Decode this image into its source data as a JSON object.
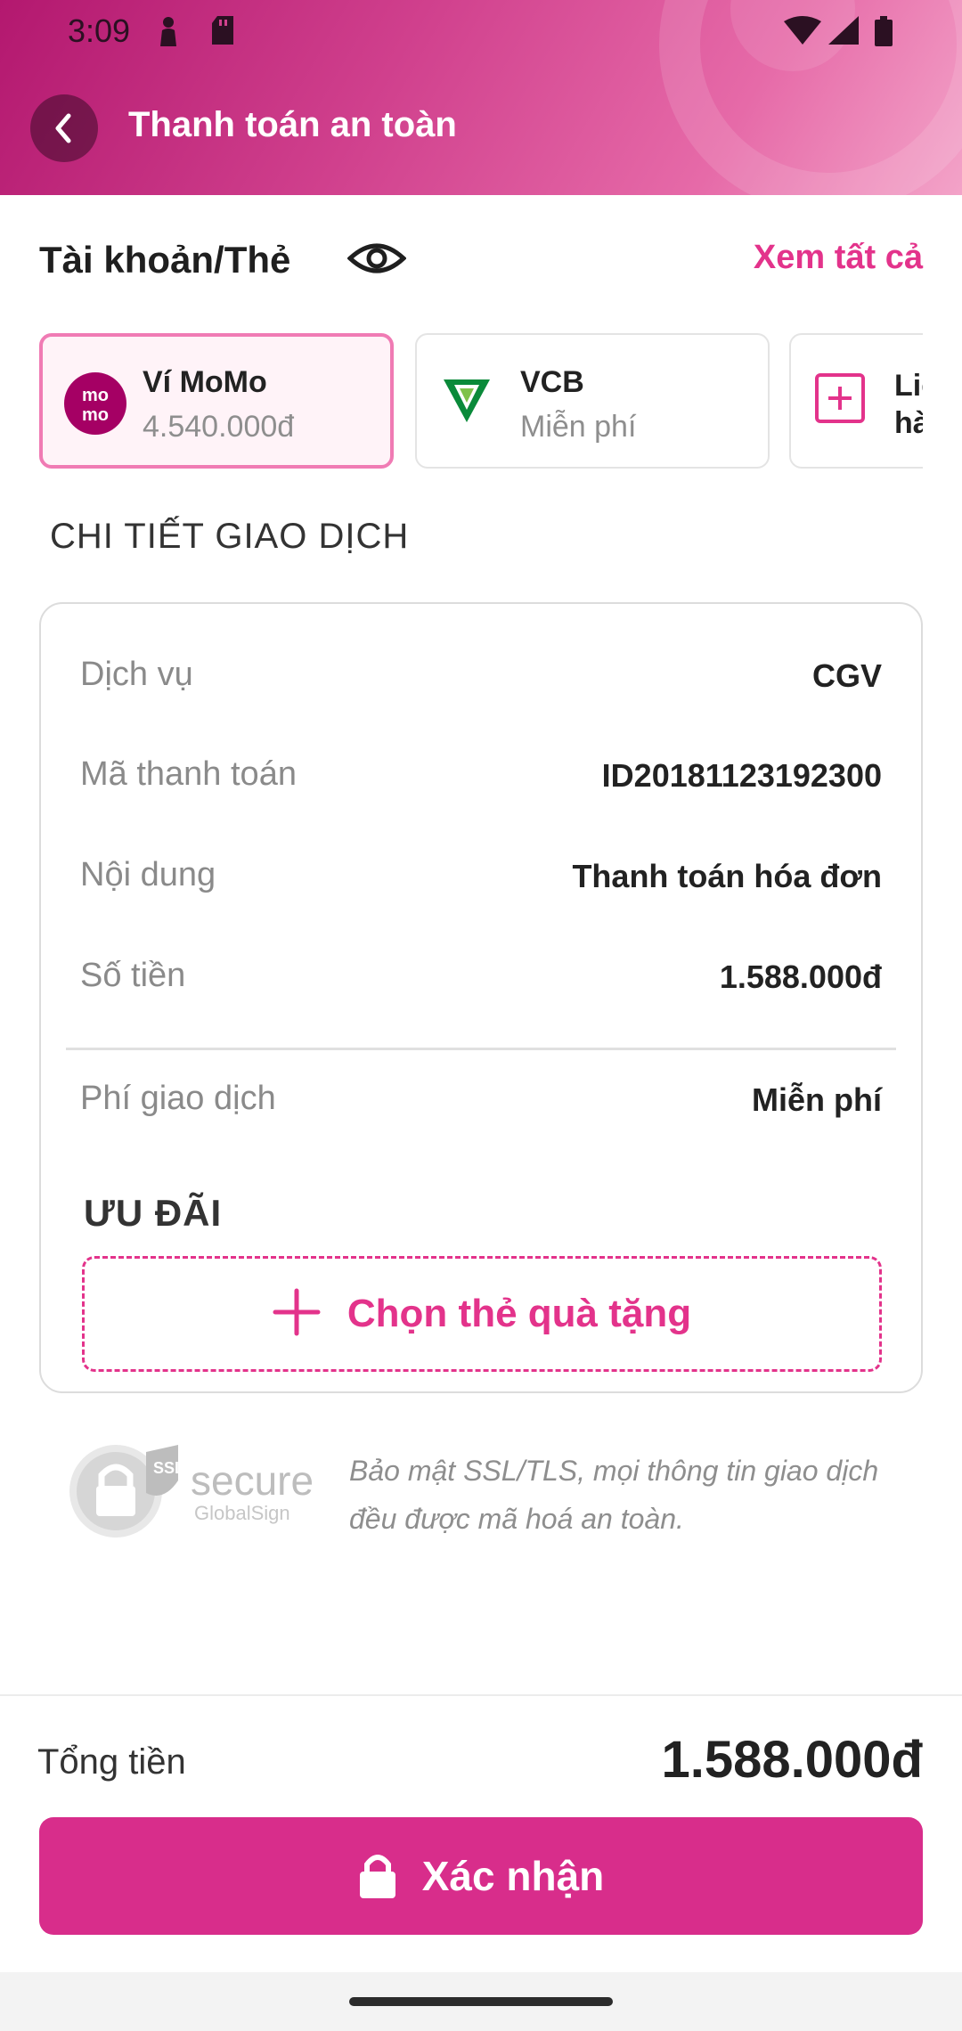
{
  "status_bar": {
    "time": "3:09"
  },
  "header": {
    "title": "Thanh toán an toàn"
  },
  "accounts": {
    "title": "Tài khoản/Thẻ",
    "see_all": "Xem tất cả",
    "cards": [
      {
        "name": "Ví MoMo",
        "sub": "4.540.000đ",
        "selected": true,
        "icon": "momo-logo"
      },
      {
        "name": "VCB",
        "sub": "Miễn phí",
        "selected": false,
        "icon": "vcb-logo"
      },
      {
        "name": "Liê",
        "sub": "hà",
        "selected": false,
        "icon": "add-card-icon"
      }
    ]
  },
  "details": {
    "section_title": "CHI TIẾT GIAO DỊCH",
    "rows": [
      {
        "label": "Dịch vụ",
        "value": "CGV"
      },
      {
        "label": "Mã thanh toán",
        "value": "ID20181123192300"
      },
      {
        "label": "Nội dung",
        "value": "Thanh toán hóa đơn"
      },
      {
        "label": "Số tiền",
        "value": "1.588.000đ"
      },
      {
        "label": "Phí giao dịch",
        "value": "Miễn phí"
      }
    ],
    "promo_title": "ƯU ĐÃI",
    "gift_button": "Chọn thẻ quà tặng"
  },
  "ssl": {
    "logo_text": "secure",
    "logo_sub": "GlobalSign",
    "note": "Bảo mật SSL/TLS, mọi thông tin giao dịch đều được mã hoá an toàn."
  },
  "footer": {
    "total_label": "Tổng tiền",
    "total_value": "1.588.000đ",
    "confirm_label": "Xác nhận"
  },
  "colors": {
    "accent": "#d82d8b",
    "accent_text": "#e3338b",
    "header": "#c22a7c"
  }
}
